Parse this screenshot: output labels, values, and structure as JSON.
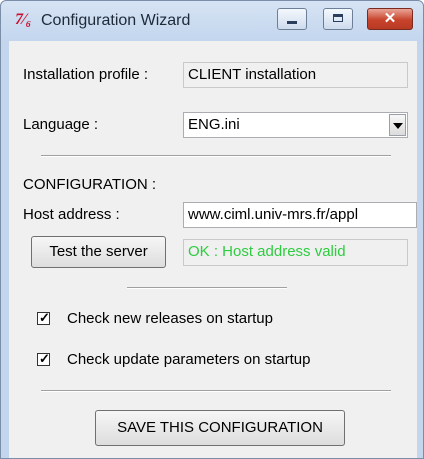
{
  "window": {
    "title": "Configuration Wizard"
  },
  "titlebar": {
    "app_icon": "tk-feather-icon",
    "close_glyph": "✕"
  },
  "profile": {
    "label": "Installation profile :",
    "value": "CLIENT installation"
  },
  "language": {
    "label": "Language :",
    "value": "ENG.ini"
  },
  "configuration": {
    "heading": "CONFIGURATION :",
    "host_label": "Host address :",
    "host_value": "www.ciml.univ-mrs.fr/appl",
    "test_button": "Test the server",
    "status_text": "OK : Host address valid",
    "status_color": "#2ecc40"
  },
  "options": [
    {
      "label": "Check new releases on startup",
      "checked": true
    },
    {
      "label": "Check update parameters on startup",
      "checked": true
    }
  ],
  "save_button": "SAVE THIS CONFIGURATION"
}
